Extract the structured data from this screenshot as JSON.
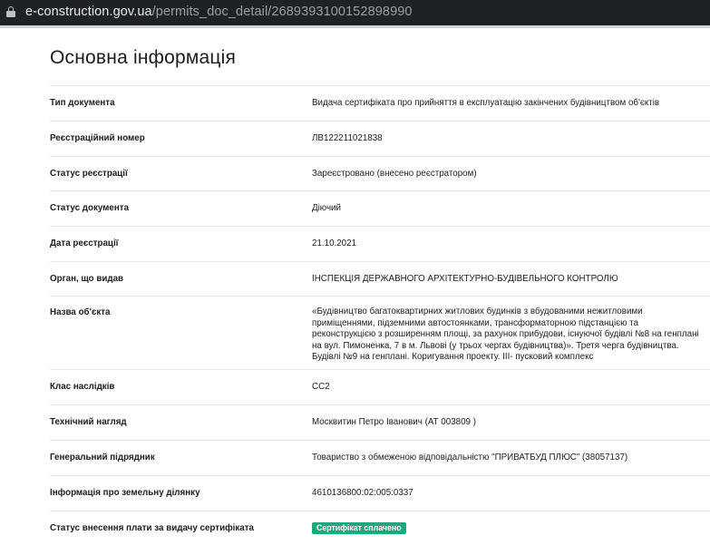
{
  "browser": {
    "url_domain": "e-construction.gov.ua",
    "url_path": "/permits_doc_detail/2689393100152898990"
  },
  "page": {
    "title": "Основна інформація"
  },
  "info_rows": [
    {
      "label": "Тип документа",
      "value": "Видача сертифіката про прийняття в експлуатацію закінчених будівництвом об'єктів"
    },
    {
      "label": "Реєстраційний номер",
      "value": "ЛВ122211021838"
    },
    {
      "label": "Статус реєстрації",
      "value": "Зареєстровано (внесено реєстратором)"
    },
    {
      "label": "Статус документа",
      "value": "Діючий"
    },
    {
      "label": "Дата реєстрації",
      "value": "21.10.2021"
    },
    {
      "label": "Орган, що видав",
      "value": "ІНСПЕКЦІЯ ДЕРЖАВНОГО АРХІТЕКТУРНО-БУДІВЕЛЬНОГО КОНТРОЛЮ"
    },
    {
      "label": "Назва об'єкта",
      "value": "«Будівництво багатоквартирних житлових будинків з вбудованими нежитловими приміщеннями, підземними автостоянками, трансформаторною підстанцією та реконструкцією з розширенням площі, за рахунок прибудови, існуючої будівлі №8 на генплані на вул. Пимоненка, 7 в м. Львові (у трьох чергах будівництва)». Третя черга будівництва. Будівлі №9 на генплані. Коригування проекту. III- пусковий комплекс"
    },
    {
      "label": "Клас наслідків",
      "value": "CC2"
    },
    {
      "label": "Технічний нагляд",
      "value": "Москвитин Петро Іванович (АТ 003809 )"
    },
    {
      "label": "Генеральний підрядник",
      "value": "Товариство з обмеженою відповідальністю \"ПРИВАТБУД ПЛЮС\" (38057137)"
    },
    {
      "label": "Інформація про земельну ділянку",
      "value": "4610136800:02:005:0337"
    },
    {
      "label": "Статус внесення плати за видачу сертифіката",
      "badge": "Сертифікат сплачено"
    }
  ],
  "colors": {
    "badge_background": "#1fa67a",
    "urlbar_background": "#202124"
  }
}
